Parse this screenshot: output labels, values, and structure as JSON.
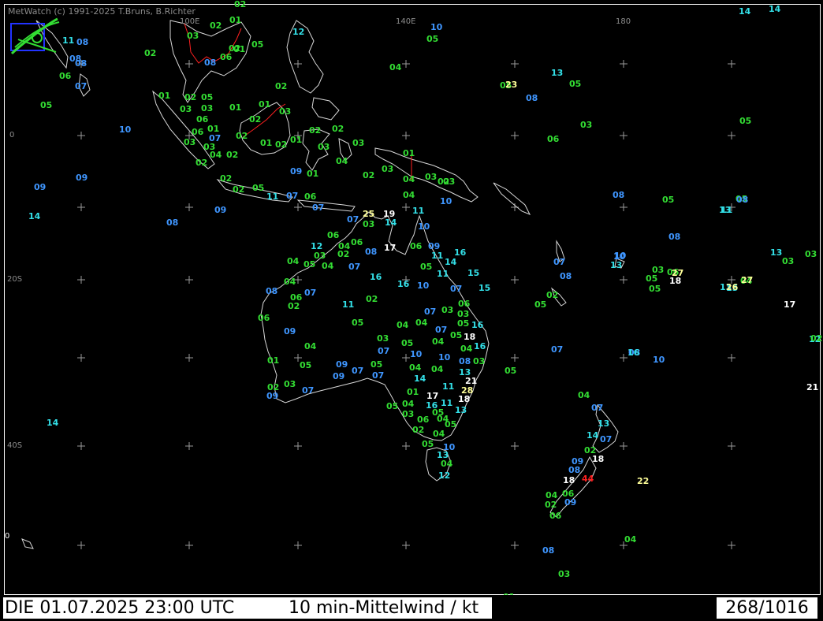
{
  "credit": "MetWatch  (c) 1991-2025 T.Bruns, B.Richter",
  "footer": {
    "datetime": "DIE 01.07.2025 23:00 UTC",
    "parameter": "10 min-Mittelwind / kt",
    "count": "268/1016"
  },
  "colors": {
    "background": "#000000",
    "frame": "#ffffff",
    "coast": "#d8d8d8",
    "border": "#ff2020",
    "grid": "#9a9a9a",
    "calm": "#33dd33",
    "light": "#3f96ff",
    "moderate": "#33e0e8",
    "fresh": "#ffffff",
    "strong": "#ffff99",
    "gale": "#ff2020"
  },
  "grid_labels": {
    "lon_100E": "100E",
    "lon_140E": "140E",
    "lon_180": "180",
    "lat_0": "0",
    "lat_20S": "20S",
    "lat_40S": "40S",
    "lat_60S": "0"
  },
  "stations": [
    {
      "v": "02",
      "c": "calm"
    },
    {
      "v": "14",
      "c": "moderate"
    },
    {
      "v": "14",
      "c": "moderate"
    },
    {
      "v": "10",
      "c": "light"
    },
    {
      "v": "12",
      "c": "moderate"
    },
    {
      "v": "05",
      "c": "calm"
    },
    {
      "v": "05",
      "c": "calm"
    },
    {
      "v": "02",
      "c": "calm"
    },
    {
      "v": "01",
      "c": "calm"
    },
    {
      "v": "02",
      "c": "calm"
    },
    {
      "v": "03",
      "c": "calm"
    },
    {
      "v": "11",
      "c": "moderate"
    },
    {
      "v": "08",
      "c": "light"
    },
    {
      "v": "02",
      "c": "calm"
    },
    {
      "v": "08",
      "c": "light"
    },
    {
      "v": "06",
      "c": "calm"
    },
    {
      "v": "01",
      "c": "calm"
    },
    {
      "v": "08",
      "c": "light"
    },
    {
      "v": "08",
      "c": "light"
    },
    {
      "v": "06",
      "c": "calm"
    },
    {
      "v": "07",
      "c": "light"
    },
    {
      "v": "04",
      "c": "calm"
    },
    {
      "v": "13",
      "c": "moderate"
    },
    {
      "v": "05",
      "c": "calm"
    },
    {
      "v": "05",
      "c": "calm"
    },
    {
      "v": "08",
      "c": "light"
    },
    {
      "v": "02",
      "c": "calm"
    },
    {
      "v": "01",
      "c": "calm"
    },
    {
      "v": "02",
      "c": "calm"
    },
    {
      "v": "05",
      "c": "calm"
    },
    {
      "v": "03",
      "c": "calm"
    },
    {
      "v": "01",
      "c": "calm"
    },
    {
      "v": "01",
      "c": "calm"
    },
    {
      "v": "03",
      "c": "calm"
    },
    {
      "v": "03",
      "c": "calm"
    },
    {
      "v": "05",
      "c": "calm"
    },
    {
      "v": "06",
      "c": "calm"
    },
    {
      "v": "02",
      "c": "calm"
    },
    {
      "v": "10",
      "c": "light"
    },
    {
      "v": "06",
      "c": "calm"
    },
    {
      "v": "01",
      "c": "calm"
    },
    {
      "v": "07",
      "c": "light"
    },
    {
      "v": "02",
      "c": "calm"
    },
    {
      "v": "02",
      "c": "calm"
    },
    {
      "v": "03",
      "c": "calm"
    },
    {
      "v": "01",
      "c": "calm"
    },
    {
      "v": "02",
      "c": "calm"
    },
    {
      "v": "01",
      "c": "calm"
    },
    {
      "v": "03",
      "c": "calm"
    },
    {
      "v": "03",
      "c": "calm"
    },
    {
      "v": "03",
      "c": "calm"
    },
    {
      "v": "06",
      "c": "calm"
    },
    {
      "v": "05",
      "c": "calm"
    },
    {
      "v": "02",
      "c": "calm"
    },
    {
      "v": "04",
      "c": "calm"
    },
    {
      "v": "02",
      "c": "calm"
    },
    {
      "v": "03",
      "c": "calm"
    },
    {
      "v": "02",
      "c": "calm"
    },
    {
      "v": "01",
      "c": "calm"
    },
    {
      "v": "04",
      "c": "calm"
    },
    {
      "v": "09",
      "c": "light"
    },
    {
      "v": "01",
      "c": "calm"
    },
    {
      "v": "02",
      "c": "calm"
    },
    {
      "v": "03",
      "c": "calm"
    },
    {
      "v": "03",
      "c": "calm"
    },
    {
      "v": "09",
      "c": "light"
    },
    {
      "v": "09",
      "c": "light"
    },
    {
      "v": "02",
      "c": "calm"
    },
    {
      "v": "02",
      "c": "calm"
    },
    {
      "v": "02",
      "c": "calm"
    },
    {
      "v": "04",
      "c": "calm"
    },
    {
      "v": "03",
      "c": "calm"
    },
    {
      "v": "05",
      "c": "calm"
    },
    {
      "v": "11",
      "c": "moderate"
    },
    {
      "v": "07",
      "c": "light"
    },
    {
      "v": "06",
      "c": "calm"
    },
    {
      "v": "04",
      "c": "calm"
    },
    {
      "v": "14",
      "c": "moderate"
    },
    {
      "v": "10",
      "c": "light"
    },
    {
      "v": "09",
      "c": "light"
    },
    {
      "v": "07",
      "c": "light"
    },
    {
      "v": "08",
      "c": "light"
    },
    {
      "v": "07",
      "c": "light"
    },
    {
      "v": "25",
      "c": "strong"
    },
    {
      "v": "19",
      "c": "fresh"
    },
    {
      "v": "03",
      "c": "calm"
    },
    {
      "v": "14",
      "c": "moderate"
    },
    {
      "v": "11",
      "c": "moderate"
    },
    {
      "v": "10",
      "c": "light"
    },
    {
      "v": "06",
      "c": "calm"
    },
    {
      "v": "06",
      "c": "calm"
    },
    {
      "v": "04",
      "c": "calm"
    },
    {
      "v": "12",
      "c": "moderate"
    },
    {
      "v": "04",
      "c": "calm"
    },
    {
      "v": "03",
      "c": "calm"
    },
    {
      "v": "02",
      "c": "calm"
    },
    {
      "v": "08",
      "c": "light"
    },
    {
      "v": "17",
      "c": "fresh"
    },
    {
      "v": "06",
      "c": "calm"
    },
    {
      "v": "09",
      "c": "light"
    },
    {
      "v": "11",
      "c": "moderate"
    },
    {
      "v": "16",
      "c": "moderate"
    },
    {
      "v": "14",
      "c": "moderate"
    },
    {
      "v": "04",
      "c": "calm"
    },
    {
      "v": "05",
      "c": "calm"
    },
    {
      "v": "07",
      "c": "light"
    },
    {
      "v": "16",
      "c": "moderate"
    },
    {
      "v": "05",
      "c": "calm"
    },
    {
      "v": "15",
      "c": "moderate"
    },
    {
      "v": "11",
      "c": "moderate"
    },
    {
      "v": "15",
      "c": "moderate"
    },
    {
      "v": "07",
      "c": "light"
    },
    {
      "v": "16",
      "c": "moderate"
    },
    {
      "v": "10",
      "c": "light"
    },
    {
      "v": "10",
      "c": "light"
    },
    {
      "v": "13",
      "c": "moderate"
    },
    {
      "v": "07",
      "c": "light"
    },
    {
      "v": "08",
      "c": "light"
    },
    {
      "v": "07",
      "c": "light"
    },
    {
      "v": "04",
      "c": "calm"
    },
    {
      "v": "06",
      "c": "calm"
    },
    {
      "v": "02",
      "c": "calm"
    },
    {
      "v": "11",
      "c": "moderate"
    },
    {
      "v": "02",
      "c": "calm"
    },
    {
      "v": "08",
      "c": "light"
    },
    {
      "v": "05",
      "c": "calm"
    },
    {
      "v": "07",
      "c": "light"
    },
    {
      "v": "03",
      "c": "calm"
    },
    {
      "v": "03",
      "c": "calm"
    },
    {
      "v": "06",
      "c": "calm"
    },
    {
      "v": "02",
      "c": "calm"
    },
    {
      "v": "05",
      "c": "calm"
    },
    {
      "v": "04",
      "c": "calm"
    },
    {
      "v": "04",
      "c": "calm"
    },
    {
      "v": "07",
      "c": "light"
    },
    {
      "v": "05",
      "c": "calm"
    },
    {
      "v": "16",
      "c": "moderate"
    },
    {
      "v": "06",
      "c": "calm"
    },
    {
      "v": "18",
      "c": "fresh"
    },
    {
      "v": "09",
      "c": "light"
    },
    {
      "v": "04",
      "c": "calm"
    },
    {
      "v": "03",
      "c": "calm"
    },
    {
      "v": "05",
      "c": "calm"
    },
    {
      "v": "04",
      "c": "calm"
    },
    {
      "v": "07",
      "c": "light"
    },
    {
      "v": "04",
      "c": "calm"
    },
    {
      "v": "16",
      "c": "moderate"
    },
    {
      "v": "10",
      "c": "light"
    },
    {
      "v": "10",
      "c": "light"
    },
    {
      "v": "08",
      "c": "light"
    },
    {
      "v": "01",
      "c": "calm"
    },
    {
      "v": "04",
      "c": "calm"
    },
    {
      "v": "05",
      "c": "calm"
    },
    {
      "v": "09",
      "c": "light"
    },
    {
      "v": "07",
      "c": "light"
    },
    {
      "v": "05",
      "c": "calm"
    },
    {
      "v": "07",
      "c": "light"
    },
    {
      "v": "04",
      "c": "calm"
    },
    {
      "v": "13",
      "c": "moderate"
    },
    {
      "v": "12",
      "c": "moderate"
    },
    {
      "v": "14",
      "c": "moderate"
    },
    {
      "v": "08",
      "c": "light"
    },
    {
      "v": "09",
      "c": "light"
    },
    {
      "v": "03",
      "c": "calm"
    },
    {
      "v": "05",
      "c": "calm"
    },
    {
      "v": "02",
      "c": "calm"
    },
    {
      "v": "03",
      "c": "calm"
    },
    {
      "v": "07",
      "c": "light"
    },
    {
      "v": "11",
      "c": "moderate"
    },
    {
      "v": "21",
      "c": "fresh"
    },
    {
      "v": "28",
      "c": "strong"
    },
    {
      "v": "09",
      "c": "light"
    },
    {
      "v": "05",
      "c": "calm"
    },
    {
      "v": "01",
      "c": "calm"
    },
    {
      "v": "17",
      "c": "fresh"
    },
    {
      "v": "18",
      "c": "fresh"
    },
    {
      "v": "04",
      "c": "calm"
    },
    {
      "v": "16",
      "c": "moderate"
    },
    {
      "v": "11",
      "c": "moderate"
    },
    {
      "v": "05",
      "c": "calm"
    },
    {
      "v": "13",
      "c": "moderate"
    },
    {
      "v": "03",
      "c": "calm"
    },
    {
      "v": "06",
      "c": "calm"
    },
    {
      "v": "04",
      "c": "calm"
    },
    {
      "v": "05",
      "c": "calm"
    },
    {
      "v": "02",
      "c": "calm"
    },
    {
      "v": "04",
      "c": "calm"
    },
    {
      "v": "05",
      "c": "calm"
    },
    {
      "v": "10",
      "c": "light"
    },
    {
      "v": "13",
      "c": "moderate"
    },
    {
      "v": "04",
      "c": "calm"
    },
    {
      "v": "12",
      "c": "moderate"
    },
    {
      "v": "14",
      "c": "moderate"
    },
    {
      "v": "10",
      "c": "light"
    },
    {
      "v": "05",
      "c": "calm"
    },
    {
      "v": "13",
      "c": "moderate"
    },
    {
      "v": "05",
      "c": "calm"
    },
    {
      "v": "08",
      "c": "light"
    },
    {
      "v": "03",
      "c": "calm"
    },
    {
      "v": "06",
      "c": "calm"
    },
    {
      "v": "05",
      "c": "calm"
    },
    {
      "v": "18",
      "c": "fresh"
    },
    {
      "v": "05",
      "c": "calm"
    },
    {
      "v": "13",
      "c": "moderate"
    },
    {
      "v": "04",
      "c": "calm"
    },
    {
      "v": "15",
      "c": "moderate"
    },
    {
      "v": "05",
      "c": "calm"
    },
    {
      "v": "07",
      "c": "light"
    },
    {
      "v": "16",
      "c": "moderate"
    },
    {
      "v": "10",
      "c": "light"
    },
    {
      "v": "04",
      "c": "calm"
    },
    {
      "v": "07",
      "c": "light"
    },
    {
      "v": "13",
      "c": "moderate"
    },
    {
      "v": "14",
      "c": "moderate"
    },
    {
      "v": "07",
      "c": "light"
    },
    {
      "v": "02",
      "c": "calm"
    },
    {
      "v": "09",
      "c": "light"
    },
    {
      "v": "18",
      "c": "fresh"
    },
    {
      "v": "08",
      "c": "light"
    },
    {
      "v": "18",
      "c": "fresh"
    },
    {
      "v": "44",
      "c": "gale"
    },
    {
      "v": "22",
      "c": "strong"
    },
    {
      "v": "04",
      "c": "calm"
    },
    {
      "v": "06",
      "c": "calm"
    },
    {
      "v": "02",
      "c": "calm"
    },
    {
      "v": "09",
      "c": "light"
    },
    {
      "v": "06",
      "c": "calm"
    },
    {
      "v": "08",
      "c": "light"
    },
    {
      "v": "04",
      "c": "calm"
    },
    {
      "v": "03",
      "c": "calm"
    },
    {
      "v": "01",
      "c": "calm"
    },
    {
      "v": "13",
      "c": "moderate"
    },
    {
      "v": "03",
      "c": "calm"
    },
    {
      "v": "03",
      "c": "calm"
    },
    {
      "v": "17",
      "c": "fresh"
    },
    {
      "v": "02",
      "c": "calm"
    },
    {
      "v": "21",
      "c": "fresh"
    },
    {
      "v": "27",
      "c": "strong"
    },
    {
      "v": "27",
      "c": "strong"
    },
    {
      "v": "26",
      "c": "strong"
    },
    {
      "v": "23",
      "c": "strong"
    },
    {
      "v": "08",
      "c": "light"
    },
    {
      "v": "11",
      "c": "moderate"
    },
    {
      "v": "08",
      "c": "light"
    },
    {
      "v": "12",
      "c": "moderate"
    },
    {
      "v": "08",
      "c": "light"
    },
    {
      "v": "16",
      "c": "moderate"
    },
    {
      "v": "14",
      "c": "moderate"
    },
    {
      "v": "02",
      "c": "calm"
    },
    {
      "v": "06",
      "c": "calm"
    },
    {
      "v": "05",
      "c": "calm"
    },
    {
      "v": "13",
      "c": "moderate"
    },
    {
      "v": "04",
      "c": "calm"
    },
    {
      "v": "18",
      "c": "fresh"
    }
  ]
}
